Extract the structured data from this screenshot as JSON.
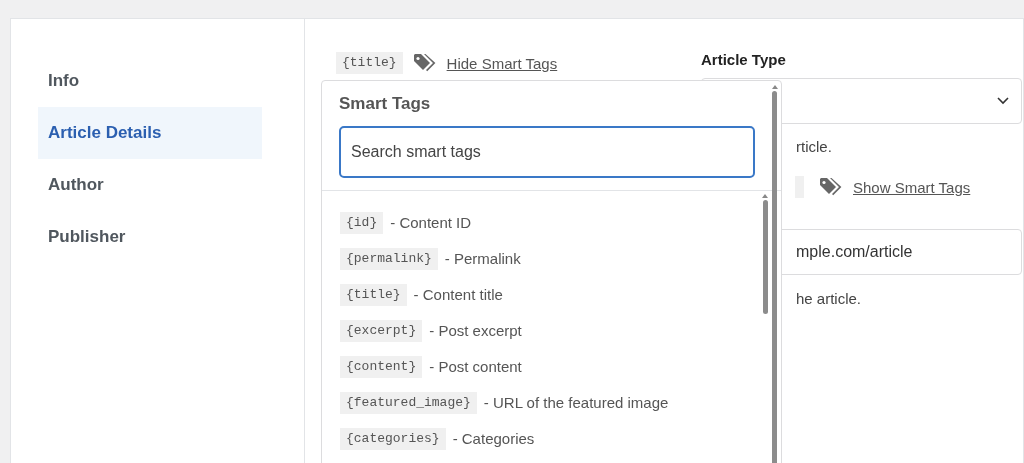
{
  "sidebar": {
    "items": [
      {
        "label": "Info",
        "selected": false
      },
      {
        "label": "Article Details",
        "selected": true
      },
      {
        "label": "Author",
        "selected": false
      },
      {
        "label": "Publisher",
        "selected": false
      }
    ]
  },
  "title_field": {
    "tag": "{title}",
    "toggle": "Hide Smart Tags"
  },
  "article_type": {
    "label": "Article Type",
    "help": "rticle."
  },
  "url_field": {
    "toggle": "Show Smart Tags",
    "value": "mple.com/article",
    "help": "he article."
  },
  "smart_tags_popup": {
    "heading": "Smart Tags",
    "search": {
      "placeholder": "Search smart tags"
    },
    "tags": [
      {
        "tag": "{id}",
        "description": "- Content ID"
      },
      {
        "tag": "{permalink}",
        "description": "- Permalink"
      },
      {
        "tag": "{title}",
        "description": "- Content title"
      },
      {
        "tag": "{excerpt}",
        "description": "- Post excerpt"
      },
      {
        "tag": "{content}",
        "description": "- Post content"
      },
      {
        "tag": "{featured_image}",
        "description": "- URL of the featured image"
      },
      {
        "tag": "{categories}",
        "description": "- Categories"
      }
    ]
  }
}
